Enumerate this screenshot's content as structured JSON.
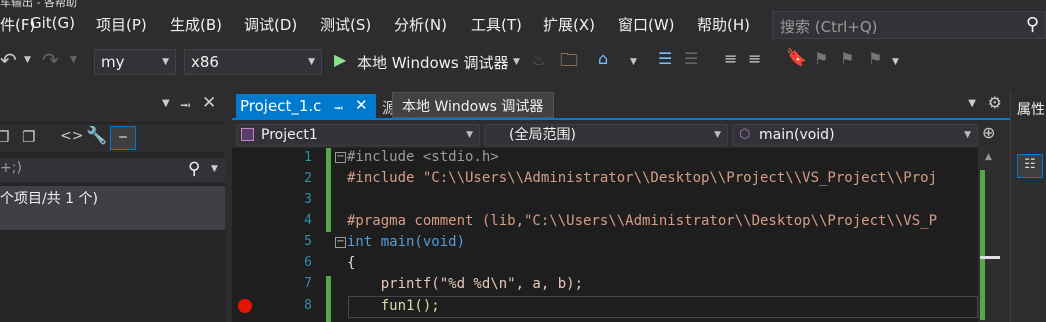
{
  "window": {
    "title_fragment": "车输出 - 各帮助"
  },
  "menu": {
    "items": [
      "Git(G)",
      "项目(P)",
      "生成(B)",
      "调试(D)",
      "测试(S)",
      "分析(N)",
      "工具(T)",
      "扩展(X)",
      "窗口(W)",
      "帮助(H)"
    ],
    "search_placeholder": "搜索 (Ctrl+Q)"
  },
  "toolbar": {
    "config": "my",
    "platform": "x86",
    "debugger": "本地 Windows 调试器"
  },
  "left_panel": {
    "search_value": "+;)",
    "summary": "个项目/共 1 个)"
  },
  "editor": {
    "tabs": [
      {
        "label": "Project_1.c"
      },
      {
        "label": "源"
      }
    ],
    "tooltip": "本地 Windows 调试器",
    "nav": {
      "project": "Project1",
      "scope": "(全局范围)",
      "member": "main(void)"
    },
    "lines": [
      {
        "num": "1",
        "text": "#include <stdio.h>"
      },
      {
        "num": "2",
        "text": "#include \"C:\\\\Users\\\\Administrator\\\\Desktop\\\\Project\\\\VS_Project\\\\Proj"
      },
      {
        "num": "3",
        "text": ""
      },
      {
        "num": "4",
        "text": ""
      },
      {
        "num": "5",
        "text": "#pragma comment (lib,\"C:\\\\Users\\\\Administrator\\\\Desktop\\\\Project\\\\VS_P"
      },
      {
        "num": "6",
        "text": "int main(void)"
      },
      {
        "num": "7",
        "text": "{"
      },
      {
        "num": "8",
        "text": "    printf(\"%d %d\\n\", a, b);"
      },
      {
        "num": "",
        "text": "    fun1();"
      }
    ],
    "breakpoint_line": "8"
  },
  "right_panel": {
    "title": "属性"
  },
  "colors": {
    "accent": "#007acc",
    "breakpoint": "#e51400",
    "changed": "#57a64a"
  }
}
